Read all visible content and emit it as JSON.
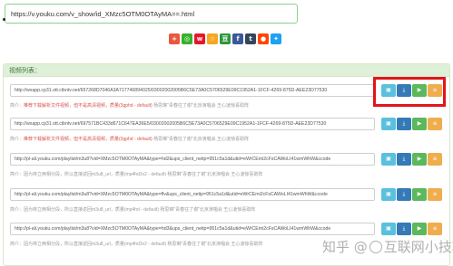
{
  "url_bar": {
    "value": "https://v.youku.com/v_show/id_XMzc5OTM0OTAyMA==.html"
  },
  "share_icons": [
    {
      "name": "plus-icon",
      "glyph": "+",
      "color": "#e9573f"
    },
    {
      "name": "wechat-icon",
      "glyph": "◎",
      "color": "#36b12b"
    },
    {
      "name": "weibo-icon",
      "glyph": "w",
      "color": "#e6162d"
    },
    {
      "name": "qzone-icon",
      "glyph": "☆",
      "color": "#f5a623"
    },
    {
      "name": "douban-icon",
      "glyph": "豆",
      "color": "#2e963d"
    },
    {
      "name": "facebook-icon",
      "glyph": "f",
      "color": "#3b5998"
    },
    {
      "name": "tumblr-icon",
      "glyph": "t",
      "color": "#35465c"
    },
    {
      "name": "reddit-icon",
      "glyph": "●",
      "color": "#ff4500"
    },
    {
      "name": "twitter-icon",
      "glyph": "✦",
      "color": "#1da1f2"
    }
  ],
  "panel": {
    "title": "视频列表："
  },
  "rows": [
    {
      "link": "http://wxapp.cp31.ott.cibntv.net/657268D7046A3A717746894025/03002002005B6C5E73A0C5706529E09C1952A1-1FCF-4269-875D-AEE23D77530",
      "warn": "推荐下载解析文件视频，但不是高清视频，质量(3gphd - default)",
      "desc": "杨思琳\"青春往了谢\"北京演唱会 王心凌惊喜助阵"
    },
    {
      "link": "http://wxapp.cp31.ott.cibntv.net/697571BC433d671C647EA36E5/03002002005B6C5E73A0C5706529E09C1952A1-1FCF-4269-875D-AEE23D77530",
      "warn": "推荐下载解析文件视频，但不是高清视频，质量(3gphd - default)",
      "desc": "杨思琳\"青春往了谢\"北京演唱会 王心凌惊喜助阵"
    },
    {
      "link": "http://pl-ali.youku.com/playlist/m3u8?vid=XMzc5OTM0OTAyMA&type=hd2&ups_client_netip=951c5a1d&utid=eWrCEmi2cFsCAWoLI41wmWhW&ccode",
      "warn": "",
      "desc": "杨思琳\"青春往了谢\"北京演唱会 王心凌惊喜助阵"
    },
    {
      "link": "http://pl-ali.youku.com/playlist/m3u8?vid=XMzc5OTM0OTAyMA&type=flv&ups_client_netip=951c5a1d&utid=eWrCEmi2cFsCAWoLI41wmWhW&ccode",
      "warn": "",
      "desc": "杨思琳\"青春往了谢\"北京演唱会 王心凌惊喜助阵"
    },
    {
      "link": "http://pl-ali.youku.com/playlist/m3u8?vid=XMzc5OTM0OTAyMA&type=hd3&ups_client_netip=951c5a1d&utid=eWrCEmi2cFsCAWoLI41wmWhW&ccode",
      "warn": "",
      "desc": "杨思琳\"青春往了谢\"北京演唱会 王心凌惊喜助阵"
    }
  ],
  "row_label": "简介：",
  "row_note_m3u8": "因为林立两相分段，所以直接返回m3u8_url，质量(mp4hd2v2 - default)",
  "row_note_m3u8_b": "因为林立两相分段，所以直接返回m3u8_url，质量(mp4hd - default)",
  "row_note_m3u8_c": "因为林立两相分段，所以直接返回m3u8_url，质量(mp4hd3v2 - default)",
  "buttons": {
    "copy": "▣",
    "download": "⤓",
    "play": "▶",
    "menu": "≡"
  },
  "watermark": {
    "text_left": "知乎 @",
    "text_right": "互联网小技巧"
  }
}
